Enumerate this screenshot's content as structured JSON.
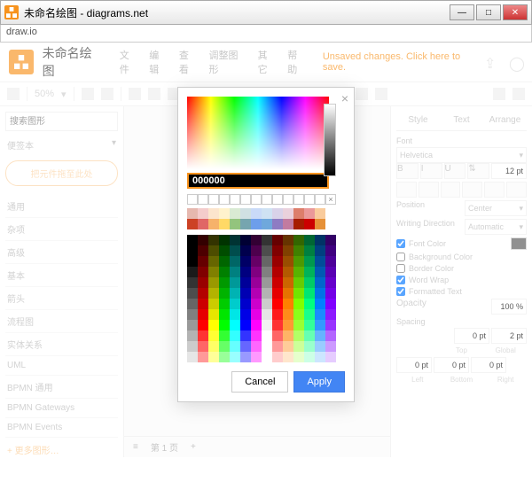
{
  "window": {
    "title": "未命名绘图 - diagrams.net",
    "address": "draw.io"
  },
  "header": {
    "docTitle": "未命名绘图",
    "unsaved": "Unsaved changes. Click here to save."
  },
  "menus": [
    "文件",
    "编辑",
    "查看",
    "调整图形",
    "其它",
    "帮助"
  ],
  "zoom": "50%",
  "sidebar": {
    "searchPlaceholder": "搜索图形",
    "paletteHeader": "便签本",
    "dropzone": "把元件拖至此处",
    "categories": [
      "通用",
      "杂项",
      "高级",
      "基本",
      "箭头",
      "流程图",
      "实体关系",
      "UML",
      "BPMN 通用",
      "BPMN Gateways",
      "BPMN Events"
    ],
    "more": "+ 更多图形…"
  },
  "pageTab": "第 1 页",
  "rightPanel": {
    "tabs": [
      "Style",
      "Text",
      "Arrange"
    ],
    "fontLabel": "Font",
    "fontName": "Helvetica",
    "fontSize": "12 pt",
    "positionLabel": "Position",
    "positionValue": "Center",
    "writingLabel": "Writing Direction",
    "writingValue": "Automatic",
    "fontColor": "Font Color",
    "bgColor": "Background Color",
    "borderColor": "Border Color",
    "wordWrap": "Word Wrap",
    "formatted": "Formatted Text",
    "opacityLabel": "Opacity",
    "opacityValue": "100 %",
    "spacingLabel": "Spacing",
    "spacingTop": "0 pt",
    "spacingGlobal": "2 pt",
    "spacingLeft": "0 pt",
    "spacingBottom": "0 pt",
    "spacingRight": "0 pt",
    "labTop": "Top",
    "labGlobal": "Global",
    "labLeft": "Left",
    "labBottom": "Bottom",
    "labRight": "Right"
  },
  "colorDialog": {
    "hex": "000000",
    "cancel": "Cancel",
    "apply": "Apply",
    "presetRows": [
      [
        "#e6b8af",
        "#f4cccc",
        "#fce5cd",
        "#fff2cc",
        "#d9ead3",
        "#d0e0e3",
        "#c9daf8",
        "#cfe2f3",
        "#d9d2e9",
        "#ead1dc",
        "#dd7e6b",
        "#ea9999",
        "#f9cb9c"
      ],
      [
        "#cc4125",
        "#e06666",
        "#f6b26b",
        "#ffd966",
        "#93c47d",
        "#76a5af",
        "#6d9eeb",
        "#6fa8dc",
        "#8e7cc3",
        "#c27ba0",
        "#a61c00",
        "#cc0000",
        "#e69138"
      ]
    ],
    "swatchRows": [
      [
        "#000000",
        "#330000",
        "#333300",
        "#003300",
        "#003333",
        "#000033",
        "#330033",
        "#333333",
        "#660000",
        "#663300",
        "#336600",
        "#006633",
        "#003366",
        "#330066"
      ],
      [
        "#000000",
        "#4d0000",
        "#4d4d00",
        "#004d00",
        "#004d4d",
        "#00004d",
        "#4d004d",
        "#4d4d4d",
        "#800000",
        "#804000",
        "#408000",
        "#008040",
        "#004080",
        "#400080"
      ],
      [
        "#000000",
        "#660000",
        "#666600",
        "#006600",
        "#006666",
        "#000066",
        "#660066",
        "#666666",
        "#990000",
        "#994d00",
        "#4d9900",
        "#00994d",
        "#004d99",
        "#4d0099"
      ],
      [
        "#1a1a1a",
        "#800000",
        "#808000",
        "#008000",
        "#008080",
        "#000080",
        "#800080",
        "#808080",
        "#b30000",
        "#b35900",
        "#59b300",
        "#00b359",
        "#0059b3",
        "#5900b3"
      ],
      [
        "#333333",
        "#990000",
        "#999900",
        "#009900",
        "#009999",
        "#000099",
        "#990099",
        "#999999",
        "#cc0000",
        "#cc6600",
        "#66cc00",
        "#00cc66",
        "#0066cc",
        "#6600cc"
      ],
      [
        "#4d4d4d",
        "#b30000",
        "#b3b300",
        "#00b300",
        "#00b3b3",
        "#0000b3",
        "#b300b3",
        "#b3b3b3",
        "#e60000",
        "#e67300",
        "#73e600",
        "#00e673",
        "#0073e6",
        "#7300e6"
      ],
      [
        "#666666",
        "#cc0000",
        "#cccc00",
        "#00cc00",
        "#00cccc",
        "#0000cc",
        "#cc00cc",
        "#cccccc",
        "#ff0000",
        "#ff8000",
        "#80ff00",
        "#00ff80",
        "#0080ff",
        "#8000ff"
      ],
      [
        "#808080",
        "#e60000",
        "#e6e600",
        "#00e600",
        "#00e6e6",
        "#0000e6",
        "#e600e6",
        "#e6e6e6",
        "#ff1a1a",
        "#ff8c1a",
        "#8cff1a",
        "#1aff8c",
        "#1a8cff",
        "#8c1aff"
      ],
      [
        "#999999",
        "#ff0000",
        "#ffff00",
        "#00ff00",
        "#00ffff",
        "#0000ff",
        "#ff00ff",
        "#f2f2f2",
        "#ff3333",
        "#ff9933",
        "#99ff33",
        "#33ff99",
        "#3399ff",
        "#9933ff"
      ],
      [
        "#b3b3b3",
        "#ff3333",
        "#ffff33",
        "#33ff33",
        "#33ffff",
        "#3333ff",
        "#ff33ff",
        "#ffffff",
        "#ff6666",
        "#ffb366",
        "#b3ff66",
        "#66ffb3",
        "#66b3ff",
        "#b366ff"
      ],
      [
        "#cccccc",
        "#ff6666",
        "#ffff66",
        "#66ff66",
        "#66ffff",
        "#6666ff",
        "#ff66ff",
        "#ffffff",
        "#ff9999",
        "#ffcc99",
        "#ccff99",
        "#99ffcc",
        "#99ccff",
        "#cc99ff"
      ],
      [
        "#e6e6e6",
        "#ff9999",
        "#ffff99",
        "#99ff99",
        "#99ffff",
        "#9999ff",
        "#ff99ff",
        "#ffffff",
        "#ffcccc",
        "#ffe6cc",
        "#e6ffcc",
        "#ccffe6",
        "#cce6ff",
        "#e6ccff"
      ]
    ]
  }
}
